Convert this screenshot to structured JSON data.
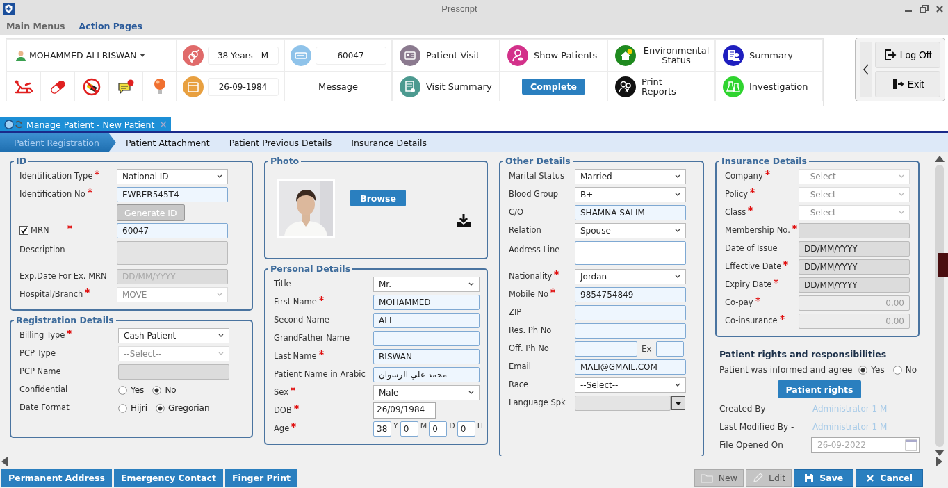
{
  "window": {
    "title": "Prescript"
  },
  "menu": [
    {
      "label": "Main Menus",
      "selected": false
    },
    {
      "label": "Action Pages",
      "selected": true
    }
  ],
  "toolbar": {
    "patient_name": "MOHAMMED ALI RISWAN",
    "age_sex": "38 Years - M",
    "dob": "26-09-1984",
    "mrn": "60047",
    "message": "Message",
    "actions": [
      {
        "label": "Patient Visit",
        "kind": "link"
      },
      {
        "label": "Show Patients",
        "kind": "link"
      },
      {
        "label": "Environmental Status",
        "kind": "link"
      },
      {
        "label": "Summary",
        "kind": "link"
      },
      {
        "label": "Visit Summary",
        "kind": "link"
      },
      {
        "label": "Complete",
        "kind": "button"
      },
      {
        "label": "Print Reports",
        "kind": "link"
      },
      {
        "label": "Investigation",
        "kind": "link"
      }
    ],
    "session": [
      {
        "label": "Log Off"
      },
      {
        "label": "Exit"
      }
    ]
  },
  "document_tab": {
    "title": "Manage Patient - New Patient"
  },
  "tabs": [
    {
      "label": "Patient Registration",
      "selected": true
    },
    {
      "label": "Patient Attachment",
      "selected": false
    },
    {
      "label": "Patient Previous Details",
      "selected": false
    },
    {
      "label": "Insurance Details",
      "selected": false
    }
  ],
  "id_section": {
    "title": "ID",
    "fields": [
      {
        "kind": "select",
        "label": "Identification Type",
        "required": true,
        "value": "National ID",
        "disabled": false
      },
      {
        "kind": "text",
        "label": "Identification No",
        "required": true,
        "value": "EWRER545T4"
      },
      {
        "kind": "button",
        "text": "Generate ID",
        "disabled": true
      },
      {
        "kind": "check",
        "label": "MRN",
        "required": true,
        "checked": true,
        "value": "60047"
      },
      {
        "kind": "area",
        "label": "Description",
        "disabled": true
      },
      {
        "kind": "readonly",
        "label": "Exp.Date For Ex. MRN",
        "placeholder": "DD/MM/YYYY"
      },
      {
        "kind": "select",
        "label": "Hospital/Branch",
        "required": true,
        "value": "MOVE",
        "disabled": true
      }
    ]
  },
  "registration": {
    "title": "Registration Details",
    "fields": [
      {
        "kind": "select",
        "label": "Billing Type",
        "required": true,
        "value": "Cash Patient",
        "disabled": false
      },
      {
        "kind": "select",
        "label": "PCP Type",
        "value": "--Select--",
        "disabled": true
      },
      {
        "kind": "readonly",
        "label": "PCP Name"
      },
      {
        "kind": "radio",
        "label": "Confidential",
        "options": [
          {
            "label": "Yes",
            "selected": false
          },
          {
            "label": "No",
            "selected": true
          }
        ]
      },
      {
        "kind": "radio",
        "label": "Date Format",
        "options": [
          {
            "label": "Hijri",
            "selected": false
          },
          {
            "label": "Gregorian",
            "selected": true
          }
        ]
      }
    ]
  },
  "photo": {
    "title": "Photo",
    "button": "Browse"
  },
  "personal": {
    "title": "Personal Details",
    "fields": [
      {
        "kind": "select",
        "label": "Title",
        "value": "Mr.",
        "disabled": false
      },
      {
        "kind": "text",
        "label": "First Name",
        "required": true,
        "value": "MOHAMMED"
      },
      {
        "kind": "text",
        "label": "Second Name",
        "value": "ALI"
      },
      {
        "kind": "text",
        "label": "GrandFather Name"
      },
      {
        "kind": "text",
        "label": "Last Name",
        "required": true,
        "value": "RISWAN"
      },
      {
        "kind": "text",
        "label": "Patient Name in Arabic",
        "value": "محمد علي الرسوان"
      },
      {
        "kind": "select",
        "label": "Sex",
        "required": true,
        "value": "Male",
        "disabled": false
      },
      {
        "kind": "date",
        "label": "DOB",
        "required": true,
        "value": "26/09/1984"
      },
      {
        "kind": "age",
        "label": "Age",
        "required": true,
        "parts": [
          {
            "value": "38",
            "unit": "Y"
          },
          {
            "value": "0",
            "unit": "M"
          },
          {
            "value": "0",
            "unit": "D"
          },
          {
            "value": "0",
            "unit": "H"
          }
        ]
      }
    ]
  },
  "other": {
    "title": "Other Details",
    "fields": [
      {
        "kind": "select",
        "label": "Marital Status",
        "value": "Married",
        "disabled": false
      },
      {
        "kind": "select",
        "label": "Blood Group",
        "value": "B+",
        "disabled": false
      },
      {
        "kind": "text",
        "label": "C/O",
        "value": "SHAMNA SALIM"
      },
      {
        "kind": "select",
        "label": "Relation",
        "value": "Spouse",
        "disabled": false
      },
      {
        "kind": "area",
        "label": "Address Line",
        "disabled": false
      },
      {
        "kind": "select",
        "label": "Nationality",
        "required": true,
        "value": "Jordan",
        "disabled": false
      },
      {
        "kind": "text",
        "label": "Mobile No",
        "required": true,
        "value": "9854754849"
      },
      {
        "kind": "text",
        "label": "ZIP"
      },
      {
        "kind": "text",
        "label": "Res. Ph No"
      },
      {
        "kind": "phone",
        "label": "Off. Ph No",
        "ext_label": "Ex"
      },
      {
        "kind": "text",
        "label": "Email",
        "value": "MALI@GMAIL.COM"
      },
      {
        "kind": "select",
        "label": "Race",
        "value": "--Select--",
        "disabled": false
      },
      {
        "kind": "combo",
        "label": "Language Spk"
      }
    ]
  },
  "insurance": {
    "title": "Insurance Details",
    "fields": [
      {
        "kind": "select",
        "label": "Company",
        "required": true,
        "value": "--Select--",
        "disabled": true
      },
      {
        "kind": "select",
        "label": "Policy",
        "required": true,
        "value": "--Select--",
        "disabled": true
      },
      {
        "kind": "select",
        "label": "Class",
        "required": true,
        "value": "--Select--",
        "disabled": true
      },
      {
        "kind": "readonly",
        "label": "Membership No.",
        "required": true
      },
      {
        "kind": "readonly",
        "label": "Date of Issue",
        "value": "DD/MM/YYYY"
      },
      {
        "kind": "readonly",
        "label": "Effective Date",
        "required": true,
        "value": "DD/MM/YYYY"
      },
      {
        "kind": "readonly",
        "label": "Expiry Date",
        "required": true,
        "value": "DD/MM/YYYY"
      },
      {
        "kind": "amount",
        "label": "Co-pay",
        "required": true,
        "placeholder": "0.00"
      },
      {
        "kind": "amount",
        "label": "Co-insurance",
        "required": true,
        "placeholder": "0.00"
      }
    ]
  },
  "patient_rights": {
    "title": "Patient rights and responsibilities",
    "question": "Patient was informed and agree",
    "options": [
      {
        "label": "Yes",
        "selected": true
      },
      {
        "label": "No",
        "selected": false
      }
    ],
    "button": "Patient rights",
    "info": [
      {
        "label": "Created By -",
        "value": "Administrator 1 M"
      },
      {
        "label": "Last Modified By -",
        "value": "Administrator 1 M"
      }
    ],
    "file_opened_label": "File Opened On",
    "file_opened": "26-09-2022"
  },
  "bottom_tabs": [
    "Permanent Address",
    "Emergency Contact",
    "Finger Print"
  ],
  "actions": [
    {
      "label": "New",
      "disabled": true
    },
    {
      "label": "Edit",
      "disabled": true
    },
    {
      "label": "Save",
      "disabled": false
    },
    {
      "label": "Cancel",
      "disabled": false
    }
  ]
}
